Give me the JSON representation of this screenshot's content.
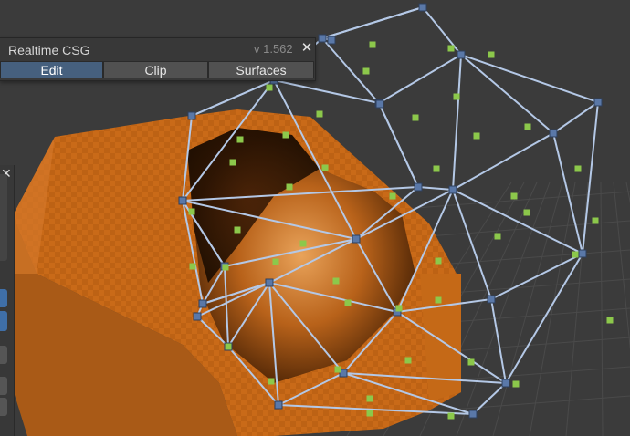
{
  "scene": {
    "colors": {
      "background": "#3b3b3b",
      "orange": "#cc6d1a",
      "wire": "#b4c8e6",
      "vertex": "#5a78a8",
      "center_handle": "#8cc84b"
    }
  },
  "csg_panel": {
    "title": "Realtime CSG",
    "version": "v 1.562",
    "close_glyph": "✕",
    "tabs": [
      {
        "label": "Edit",
        "active": true
      },
      {
        "label": "Clip",
        "active": false
      },
      {
        "label": "Surfaces",
        "active": false
      }
    ]
  },
  "side_panel": {
    "close_glyph": "✕"
  }
}
